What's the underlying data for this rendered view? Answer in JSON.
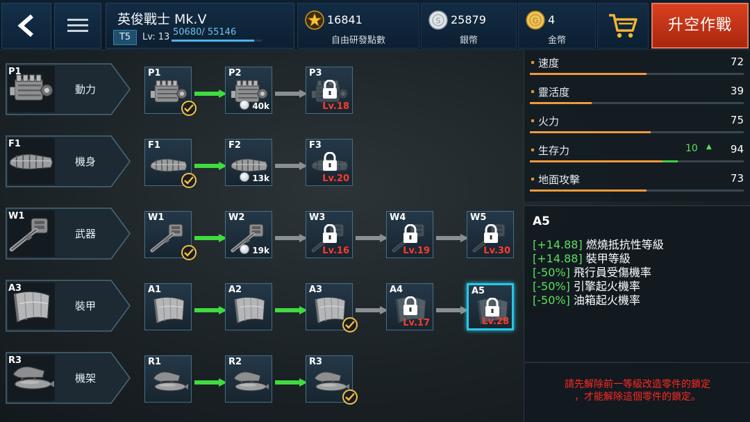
{
  "topbar": {
    "plane_name": "英俊戰士 Mk.V",
    "tier": "T5",
    "level_label": "Lv: 13",
    "xp_text": "50680/ 55146",
    "xp_progress": 0.918,
    "currencies": [
      {
        "icon": "star-icon",
        "value": "16841",
        "label": "自由研發點數"
      },
      {
        "icon": "silver-coin-icon",
        "value": "25879",
        "label": "銀幣"
      },
      {
        "icon": "gold-coin-icon",
        "value": "4",
        "label": "金幣"
      }
    ],
    "launch_label": "升空作戰"
  },
  "categories": [
    {
      "code": "P1",
      "name": "動力",
      "kind": "engine",
      "parts": [
        {
          "code": "P1",
          "state": "done"
        },
        {
          "code": "P2",
          "state": "buy",
          "cost": "40k"
        },
        {
          "code": "P3",
          "state": "locked",
          "req": "Lv.18"
        }
      ]
    },
    {
      "code": "F1",
      "name": "機身",
      "kind": "fuselage",
      "parts": [
        {
          "code": "F1",
          "state": "done"
        },
        {
          "code": "F2",
          "state": "buy",
          "cost": "13k"
        },
        {
          "code": "F3",
          "state": "locked",
          "req": "Lv.20"
        }
      ]
    },
    {
      "code": "W1",
      "name": "武器",
      "kind": "gun",
      "parts": [
        {
          "code": "W1",
          "state": "done"
        },
        {
          "code": "W2",
          "state": "buy",
          "cost": "19k"
        },
        {
          "code": "W3",
          "state": "locked",
          "req": "Lv.16"
        },
        {
          "code": "W4",
          "state": "locked",
          "req": "Lv.19"
        },
        {
          "code": "W5",
          "state": "locked",
          "req": "Lv.30"
        }
      ]
    },
    {
      "code": "A3",
      "name": "裝甲",
      "kind": "armor",
      "parts": [
        {
          "code": "A1",
          "state": "owned"
        },
        {
          "code": "A2",
          "state": "owned"
        },
        {
          "code": "A3",
          "state": "done"
        },
        {
          "code": "A4",
          "state": "locked",
          "req": "Lv.17"
        },
        {
          "code": "A5",
          "state": "locked",
          "req": "Lv.28",
          "selected": true
        }
      ]
    },
    {
      "code": "R3",
      "name": "機架",
      "kind": "rack",
      "parts": [
        {
          "code": "R1",
          "state": "owned"
        },
        {
          "code": "R2",
          "state": "owned"
        },
        {
          "code": "R3",
          "state": "done"
        }
      ]
    }
  ],
  "stats": [
    {
      "label": "速度",
      "value": "72",
      "fill": 0.545
    },
    {
      "label": "靈活度",
      "value": "39",
      "fill": 0.29
    },
    {
      "label": "火力",
      "value": "75",
      "fill": 0.565
    },
    {
      "label": "生存力",
      "value": "94",
      "bonus": "10",
      "fill": 0.62,
      "bonus_fill": 0.07
    },
    {
      "label": "地面攻擊",
      "value": "73",
      "fill": 0.545
    }
  ],
  "detail": {
    "title": "A5",
    "lines": [
      {
        "val": "[+14.88]",
        "text": " 燃燒抵抗性等級"
      },
      {
        "val": "[+14.88]",
        "text": " 裝甲等級"
      },
      {
        "val": "[-50%]",
        "text": " 飛行員受傷機率"
      },
      {
        "val": "[-50%]",
        "text": " 引擎起火機率"
      },
      {
        "val": "[-50%]",
        "text": " 油箱起火機率"
      }
    ]
  },
  "warning": {
    "line1": "請先解除前一等級改造零件的鎖定",
    "line2": "，才能解除這個零件的鎖定。"
  },
  "colors": {
    "accent_blue": "#29c6e8",
    "lock_red": "#ff3a2e",
    "green": "#5de05d",
    "orange": "#f09a3a",
    "launch": "#c6331a"
  }
}
